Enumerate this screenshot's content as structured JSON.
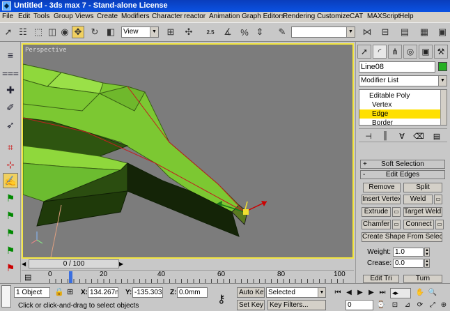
{
  "window": {
    "title": "Untitled - 3ds max 7 - Stand-alone License",
    "icon": "3ds-max-logo-icon"
  },
  "menu": [
    "File",
    "Edit",
    "Tools",
    "Group",
    "Views",
    "Create",
    "Modifiers",
    "Character",
    "reactor",
    "Animation",
    "Graph Editors",
    "Rendering",
    "Customize",
    "CAT",
    "MAXScript",
    "Help"
  ],
  "toolbar": {
    "reference_coord": "View",
    "snap_label": "2.5",
    "selection_set": ""
  },
  "viewport": {
    "label": "Perspective",
    "accent_color": "#f3e540",
    "mesh_color": "#7cc832"
  },
  "timeslider": {
    "label": "0 / 100"
  },
  "track": {
    "labels": [
      "0",
      "20",
      "40",
      "60",
      "80",
      "100"
    ]
  },
  "command_panel": {
    "object_name": "Line08",
    "object_color": "#26b024",
    "modifier_list": "Modifier List",
    "stack": [
      {
        "label": "Editable Poly",
        "level": 0,
        "selected": false
      },
      {
        "label": "Vertex",
        "level": 1,
        "selected": false
      },
      {
        "label": "Edge",
        "level": 1,
        "selected": true
      },
      {
        "label": "Border",
        "level": 1,
        "selected": false
      }
    ],
    "rollouts": {
      "soft_selection": "Soft Selection",
      "edit_edges": "Edit Edges",
      "soft_sign": "+",
      "edit_sign": "-"
    },
    "buttons": {
      "remove": "Remove",
      "split": "Split",
      "insert_vertex": "Insert Vertex",
      "weld": "Weld",
      "extrude": "Extrude",
      "target_weld": "Target Weld",
      "chamfer": "Chamfer",
      "connect": "Connect",
      "create_shape": "Create Shape From Selection",
      "edit_tri": "Edit Tri",
      "turn": "Turn"
    },
    "weight_label": "Weight:",
    "weight_value": "1.0",
    "crease_label": "Crease:",
    "crease_value": "0.0"
  },
  "status": {
    "object_count": "1 Object",
    "x_label": "X:",
    "x_value": "134.267mm",
    "y_label": "Y:",
    "y_value": "-135.303mm",
    "z_label": "Z:",
    "z_value": "0.0mm",
    "auto_key": "Auto Key",
    "set_key": "Set Key",
    "key_mode": "Selected",
    "key_filters": "Key Filters...",
    "prompt": "Click or click-and-drag to select objects",
    "frame": "0"
  }
}
